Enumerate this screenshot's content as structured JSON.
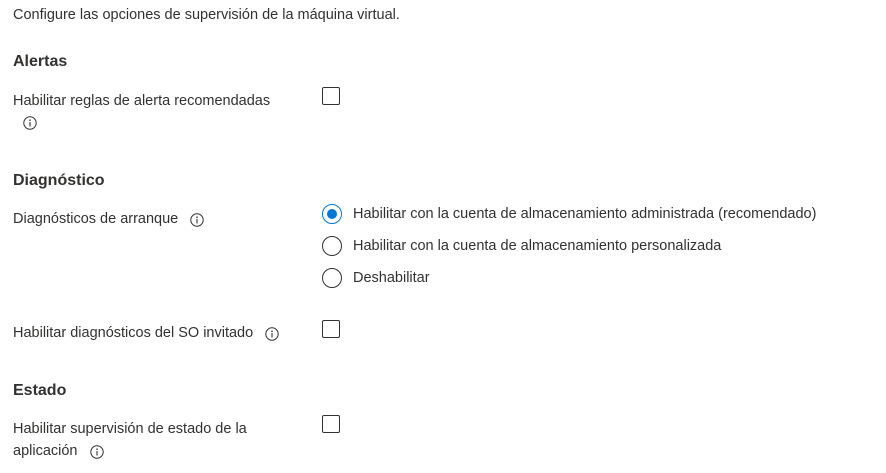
{
  "intro_text": "Configure las opciones de supervisión de la máquina virtual.",
  "sections": {
    "alerts": {
      "title": "Alertas",
      "enable_alert_rules_label": "Habilitar reglas de alerta recomendadas",
      "enable_alert_rules_checked": false
    },
    "diagnostics": {
      "title": "Diagnóstico",
      "boot_diagnostics_label": "Diagnósticos de arranque",
      "boot_options": [
        {
          "label": "Habilitar con la cuenta de almacenamiento administrada (recomendado)",
          "selected": true
        },
        {
          "label": "Habilitar con la cuenta de almacenamiento personalizada",
          "selected": false
        },
        {
          "label": "Deshabilitar",
          "selected": false
        }
      ],
      "guest_os_label": "Habilitar diagnósticos del SO invitado",
      "guest_os_checked": false
    },
    "health": {
      "title": "Estado",
      "app_health_label_line1": "Habilitar supervisión de estado de la",
      "app_health_label_line2": "aplicación",
      "app_health_checked": false
    }
  },
  "colors": {
    "accent": "#0078d4",
    "text": "#323130"
  },
  "icons": {
    "info": "info-icon"
  }
}
